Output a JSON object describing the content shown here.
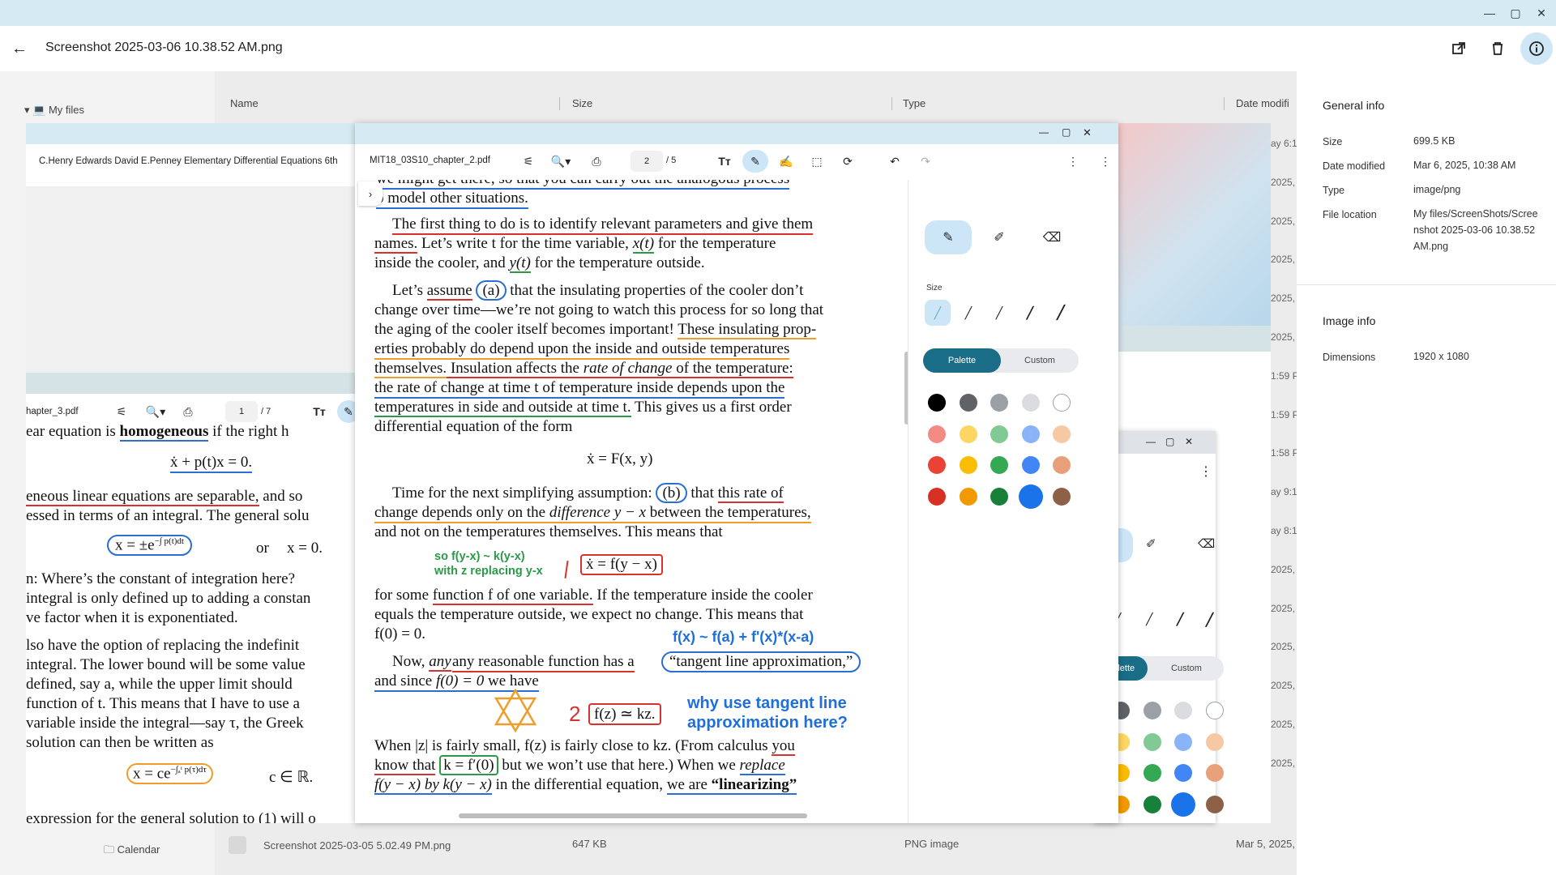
{
  "window": {
    "title": "Screenshot 2025-03-06 10.38.52 AM.png",
    "controls": {
      "minimize": "—",
      "maximize": "▢",
      "close": "✕"
    }
  },
  "toolbar_icons": [
    "open-external-icon",
    "trash-icon",
    "info-icon"
  ],
  "file_manager": {
    "sidebar": {
      "my_files": "My files",
      "calendar": "Calendar"
    },
    "columns": {
      "name": "Name",
      "size": "Size",
      "type": "Type",
      "date": "Date modifi"
    },
    "right_dates": [
      "ay 6:1",
      "2025,",
      "2025,",
      "2025,",
      "2025,",
      "2025,",
      "1:59 P",
      "1:59 P",
      "1:58 P",
      "ay 9:1",
      "ay 8:1",
      "2025,",
      "2025,",
      "2025,",
      "2025,",
      "2025,",
      "2025,"
    ],
    "bottom_row": {
      "name": "Screenshot 2025-03-05 5.02.49 PM.png",
      "size": "647 KB",
      "type": "PNG image",
      "date": "Mar 5, 2025,"
    }
  },
  "info_panel": {
    "general_title": "General info",
    "fields": [
      {
        "key": "Size",
        "value": "699.5 KB"
      },
      {
        "key": "Date modified",
        "value": "Mar 6, 2025, 10:38 AM"
      },
      {
        "key": "Type",
        "value": "image/png"
      },
      {
        "key": "File location",
        "value": "My files/ScreenShots/Screenshot 2025-03-06 10.38.52 AM.png"
      }
    ],
    "image_title": "Image info",
    "dimensions_key": "Dimensions",
    "dimensions_value": "1920 x 1080"
  },
  "book_window": {
    "title": "C.Henry Edwards David E.Penney Elementary Differential Equations 6th"
  },
  "left_pdf": {
    "filename": "hapter_3.pdf",
    "page": "1",
    "total": "/ 7",
    "lines": {
      "l1a": "ear equation is ",
      "l1b": "homogeneous",
      "l1c": " if the right h",
      "eq1": "ẋ + p(t)x = 0.",
      "l2a": "eneous linear equations are separable,",
      "l2b": " and so",
      "l3": "essed in terms of an integral. The general solu",
      "eq2a": "x = ±e",
      "eq2exp": "−∫ p(t)dt",
      "eq2b": "or",
      "eq2c": "x = 0.",
      "l4": "n: Where’s the constant of integration here?",
      "l5": " integral is only defined up to adding a constan",
      "l6": "ve factor when it is exponentiated.",
      "l7": "lso have the option of replacing the indefinit",
      "l8": " integral. The lower bound will be some value",
      "l9": " defined, say a, while the upper limit should",
      "l10": " function of t. This means that I have to use a",
      "l11": "variable inside the integral—say τ, the Greek",
      "l12": " solution can then be written as",
      "eq3a": "x = ce",
      "eq3exp": "−∫ₐᵗ p(τ)dτ",
      "eq3b": "c ∈ ℝ.",
      "l13": "expression for the general solution to (1) will o"
    }
  },
  "main_pdf": {
    "filename": "MIT18_03S10_chapter_2.pdf",
    "page": "2",
    "total": "/ 5",
    "lines": {
      "t0": "we might get there, so that you can carry out the analogous process",
      "t1": "o model other situations.",
      "p1a": "The first thing to do is to identify relevant parameters and give them",
      "p1b": "names.",
      "p1c": " Let’s write t for the time variable, ",
      "p1d": "x(t)",
      "p1e": " for the temperature",
      "p1f": "inside the cooler, and ",
      "p1g": "y(t)",
      "p1h": " for the temperature outside.",
      "p2a": "Let’s ",
      "p2b": "assume",
      "p2c": "(a)",
      "p2d": " that the insulating properties of the cooler don’t",
      "p2e": "change over time—we’re not going to watch this process for so long that",
      "p2f": "the aging of the cooler itself becomes important! ",
      "p2g": "These insulating prop-",
      "p2h": "erties probably do depend upon the inside and outside temperatures",
      "p2i": "themselves.",
      "p2j": " Insulation affects the ",
      "p2k": "rate of change",
      "p2l": " of the temperature:",
      "p2m": "the rate of change at time t of temperature inside depends upon the",
      "p2n": "temperatures in side and outside at time t.",
      "p2o": " This gives us a first order",
      "p2p": "differential equation of the form",
      "eqA": "ẋ = F(x, y)",
      "p3a": "Time for the next simplifying assumption: ",
      "p3b": "(b)",
      "p3c": " that ",
      "p3d": "this rate of",
      "p3e": "change depends only on the ",
      "p3f": "difference y − x",
      "p3g": " between the temperatures,",
      "p3h": "and not on the temperatures themselves. This means that",
      "h1": "so f(y-x) ~ k(y-x)",
      "h2": "with z replacing y-x",
      "eqB": "ẋ = f(y − x)",
      "p4a": "for some ",
      "p4b": "function f of one variable.",
      "p4c": " If the temperature inside the cooler",
      "p4d": "equals the temperature outside, we expect no change. This means that",
      "p4e": "f(0) = 0.",
      "h3": "f(x) ~ f(a) + f'(x)*(x-a)",
      "p5a": "Now, ",
      "p5b": "any reasonable function has a",
      "p5c": "“tangent line approximation,”",
      "p5d": "and since ",
      "p5e": "f(0) = 0",
      "p5f": " we have",
      "h4": "2",
      "eqC": "f(z) ≃ kz.",
      "h5": "why use tangent line",
      "h6": "approximation here?",
      "p6a": "When |z| is fairly small, f(z) is fairly close to kz. (From calculus ",
      "p6b": "you",
      "p6c": "know that",
      "p6d": "k = f′(0)",
      "p6e": " but we won’t use that here.) When we ",
      "p6f": "replace",
      "p6g": "f(y − x) by k(y − x)",
      "p6h": " in the differential equation, ",
      "p6i": "we are",
      "p6j": " “linearizing”"
    }
  },
  "annotation_panel": {
    "size_label": "Size",
    "palette_tab": "Palette",
    "custom_tab": "Custom",
    "colors": [
      [
        "#000000",
        "#5f6368",
        "#9aa0a6",
        "#dadce0",
        "#ffffff"
      ],
      [
        "#f28b82",
        "#fdd663",
        "#81c995",
        "#8ab4f8",
        "#f6c8a4"
      ],
      [
        "#ea4335",
        "#fbbc04",
        "#34a853",
        "#4285f4",
        "#e8a07a"
      ],
      [
        "#d93025",
        "#f29900",
        "#188038",
        "#1a73e8",
        "#8d6048"
      ]
    ]
  },
  "back_window": {
    "palette_tab": "Palette",
    "custom_tab": "Custom",
    "colors": [
      [
        "#5f6368",
        "#9aa0a6",
        "#dadce0",
        "#ffffff"
      ],
      [
        "#fdd663",
        "#81c995",
        "#8ab4f8",
        "#f6c8a4"
      ],
      [
        "#fbbc04",
        "#34a853",
        "#4285f4",
        "#e8a07a"
      ],
      [
        "#f29900",
        "#188038",
        "#1a73e8",
        "#8d6048"
      ]
    ]
  }
}
